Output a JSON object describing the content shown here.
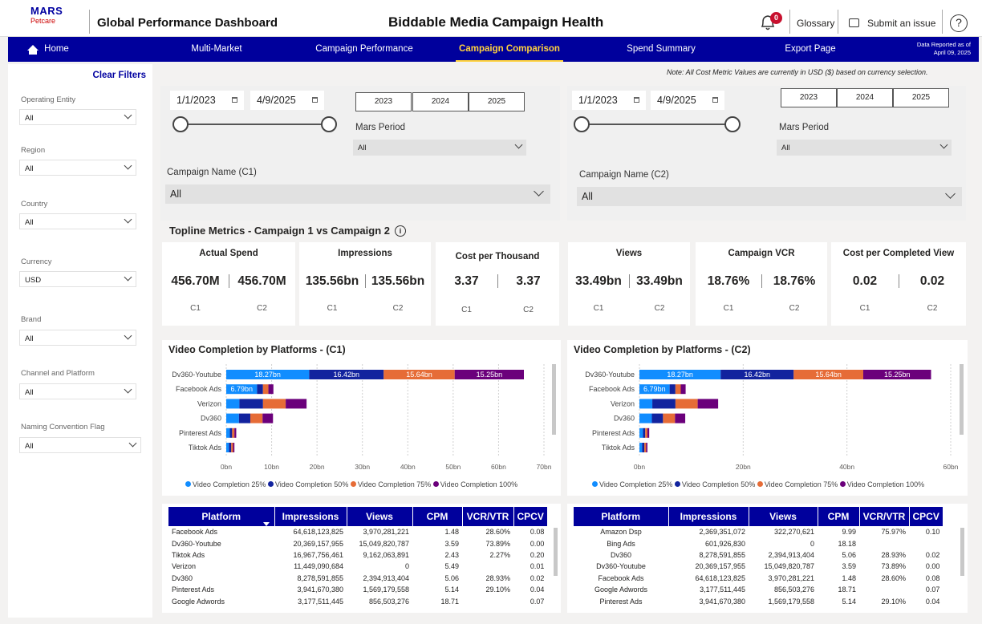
{
  "header": {
    "logo_line1": "MARS",
    "logo_line2": "Petcare",
    "app_title": "Global Performance Dashboard",
    "page_title": "Biddable Media Campaign Health",
    "notification_count": "0",
    "glossary": "Glossary",
    "submit_issue": "Submit an issue",
    "help": "?"
  },
  "nav": {
    "items": [
      "Home",
      "Multi-Market",
      "Campaign Performance",
      "Campaign Comparison",
      "Spend Summary",
      "Export Page"
    ],
    "active": "Campaign Comparison",
    "reported_line1": "Data Reported as of",
    "reported_line2": "April 09, 2025"
  },
  "sidebar": {
    "clear_filters": "Clear Filters",
    "filters": [
      {
        "label": "Operating Entity",
        "value": "All"
      },
      {
        "label": "Region",
        "value": "All"
      },
      {
        "label": "Country",
        "value": "All"
      },
      {
        "label": "Currency",
        "value": "USD"
      },
      {
        "label": "Brand",
        "value": "All"
      },
      {
        "label": "Channel and Platform",
        "value": "All"
      },
      {
        "label": "Naming Convention Flag",
        "value": "All"
      }
    ]
  },
  "note": "Note: All Cost Metric Values are currently in USD ($) based on currency selection.",
  "panels": [
    {
      "start_date": "1/1/2023",
      "end_date": "4/9/2025",
      "years": [
        "2023",
        "2024",
        "2025"
      ],
      "mars_period_label": "Mars Period",
      "mars_period_value": "All",
      "campaign_label": "Campaign Name (C1)",
      "campaign_value": "All"
    },
    {
      "start_date": "1/1/2023",
      "end_date": "4/9/2025",
      "years": [
        "2023",
        "2024",
        "2025"
      ],
      "mars_period_label": "Mars Period",
      "mars_period_value": "All",
      "campaign_label": "Campaign Name (C2)",
      "campaign_value": "All"
    }
  ],
  "topline": {
    "title": "Topline Metrics - Campaign 1 vs Campaign 2",
    "info_icon": "i",
    "c1_label": "C1",
    "c2_label": "C2",
    "cards": [
      {
        "title": "Actual Spend",
        "c1": "456.70M",
        "c2": "456.70M"
      },
      {
        "title": "Impressions",
        "c1": "135.56bn",
        "c2": "135.56bn"
      },
      {
        "title": "Cost per Thousand",
        "c1": "3.37",
        "c2": "3.37"
      },
      {
        "title": "Views",
        "c1": "33.49bn",
        "c2": "33.49bn"
      },
      {
        "title": "Campaign VCR",
        "c1": "18.76%",
        "c2": "18.76%"
      },
      {
        "title": "Cost per Completed View",
        "c1": "0.02",
        "c2": "0.02"
      }
    ]
  },
  "chart_data": [
    {
      "type": "bar",
      "orientation": "horizontal",
      "stacked": true,
      "title": "Video Completion by Platforms - (C1)",
      "categories": [
        "Dv360-Youtube",
        "Facebook Ads",
        "Verizon",
        "Dv360",
        "Pinterest Ads",
        "Tiktok Ads"
      ],
      "series": [
        {
          "name": "Video Completion 25%",
          "color": "#118dff",
          "values": [
            18.27,
            6.79,
            2.9,
            2.8,
            0.8,
            0.6
          ],
          "labels": [
            "18.27bn",
            "6.79bn",
            "",
            "",
            "",
            ""
          ]
        },
        {
          "name": "Video Completion 50%",
          "color": "#12239e",
          "values": [
            16.42,
            1.3,
            5.2,
            2.5,
            0.5,
            0.5
          ],
          "labels": [
            "16.42bn",
            "",
            "",
            "",
            "",
            ""
          ]
        },
        {
          "name": "Video Completion 75%",
          "color": "#e66c37",
          "values": [
            15.64,
            1.2,
            5.0,
            2.7,
            0.5,
            0.4
          ],
          "labels": [
            "15.64bn",
            "",
            "",
            "",
            "",
            ""
          ]
        },
        {
          "name": "Video Completion 100%",
          "color": "#6b007b",
          "values": [
            15.25,
            1.1,
            4.6,
            2.3,
            0.4,
            0.3
          ],
          "labels": [
            "15.25bn",
            "",
            "",
            "",
            "",
            ""
          ]
        }
      ],
      "xlim": [
        0,
        70
      ],
      "xticks": [
        "0bn",
        "10bn",
        "20bn",
        "30bn",
        "40bn",
        "50bn",
        "60bn",
        "70bn"
      ],
      "grid": true,
      "legend": "bottom"
    },
    {
      "type": "bar",
      "orientation": "horizontal",
      "stacked": true,
      "title": "Video Completion by Platforms - (C2)",
      "categories": [
        "Dv360-Youtube",
        "Facebook Ads",
        "Verizon",
        "Dv360",
        "Pinterest Ads",
        "Tiktok Ads"
      ],
      "series": [
        {
          "name": "Video Completion 25%",
          "color": "#118dff",
          "values": [
            18.27,
            6.79,
            2.9,
            2.8,
            0.8,
            0.6
          ],
          "labels": [
            "18.27bn",
            "6.79bn",
            "",
            "",
            "",
            ""
          ]
        },
        {
          "name": "Video Completion 50%",
          "color": "#12239e",
          "values": [
            16.42,
            1.3,
            5.2,
            2.5,
            0.5,
            0.5
          ],
          "labels": [
            "16.42bn",
            "",
            "",
            "",
            "",
            ""
          ]
        },
        {
          "name": "Video Completion 75%",
          "color": "#e66c37",
          "values": [
            15.64,
            1.2,
            5.0,
            2.7,
            0.5,
            0.4
          ],
          "labels": [
            "15.64bn",
            "",
            "",
            "",
            "",
            ""
          ]
        },
        {
          "name": "Video Completion 100%",
          "color": "#6b007b",
          "values": [
            15.25,
            1.1,
            4.6,
            2.3,
            0.4,
            0.3
          ],
          "labels": [
            "15.25bn",
            "",
            "",
            "",
            "",
            ""
          ]
        }
      ],
      "xlim": [
        0,
        70
      ],
      "xticks": [
        "0bn",
        "20bn",
        "40bn",
        "60bn"
      ],
      "grid": true,
      "legend": "bottom"
    }
  ],
  "tables": [
    {
      "columns": [
        "Platform",
        "Impressions",
        "Views",
        "CPM",
        "VCR/VTR",
        "CPCV"
      ],
      "rows": [
        [
          "Facebook Ads",
          "64,618,123,825",
          "3,970,281,221",
          "1.48",
          "28.60%",
          "0.08"
        ],
        [
          "Dv360-Youtube",
          "20,369,157,955",
          "15,049,820,787",
          "3.59",
          "73.89%",
          "0.00"
        ],
        [
          "Tiktok Ads",
          "16,967,756,461",
          "9,162,063,891",
          "2.43",
          "2.27%",
          "0.20"
        ],
        [
          "Verizon",
          "11,449,090,684",
          "0",
          "5.49",
          "",
          "0.01"
        ],
        [
          "Dv360",
          "8,278,591,855",
          "2,394,913,404",
          "5.06",
          "28.93%",
          "0.02"
        ],
        [
          "Pinterest Ads",
          "3,941,670,380",
          "1,569,179,558",
          "5.14",
          "29.10%",
          "0.04"
        ],
        [
          "Google Adwords",
          "3,177,511,445",
          "856,503,276",
          "18.71",
          "",
          "0.07"
        ]
      ]
    },
    {
      "columns": [
        "Platform",
        "Impressions",
        "Views",
        "CPM",
        "VCR/VTR",
        "CPCV"
      ],
      "rows": [
        [
          "Amazon Dsp",
          "2,369,351,072",
          "322,270,621",
          "9.99",
          "75.97%",
          "0.10"
        ],
        [
          "Bing Ads",
          "601,926,830",
          "0",
          "18.18",
          "",
          ""
        ],
        [
          "Dv360",
          "8,278,591,855",
          "2,394,913,404",
          "5.06",
          "28.93%",
          "0.02"
        ],
        [
          "Dv360-Youtube",
          "20,369,157,955",
          "15,049,820,787",
          "3.59",
          "73.89%",
          "0.00"
        ],
        [
          "Facebook Ads",
          "64,618,123,825",
          "3,970,281,221",
          "1.48",
          "28.60%",
          "0.08"
        ],
        [
          "Google Adwords",
          "3,177,511,445",
          "856,503,276",
          "18.71",
          "",
          "0.07"
        ],
        [
          "Pinterest Ads",
          "3,941,670,380",
          "1,569,179,558",
          "5.14",
          "29.10%",
          "0.04"
        ]
      ]
    }
  ]
}
